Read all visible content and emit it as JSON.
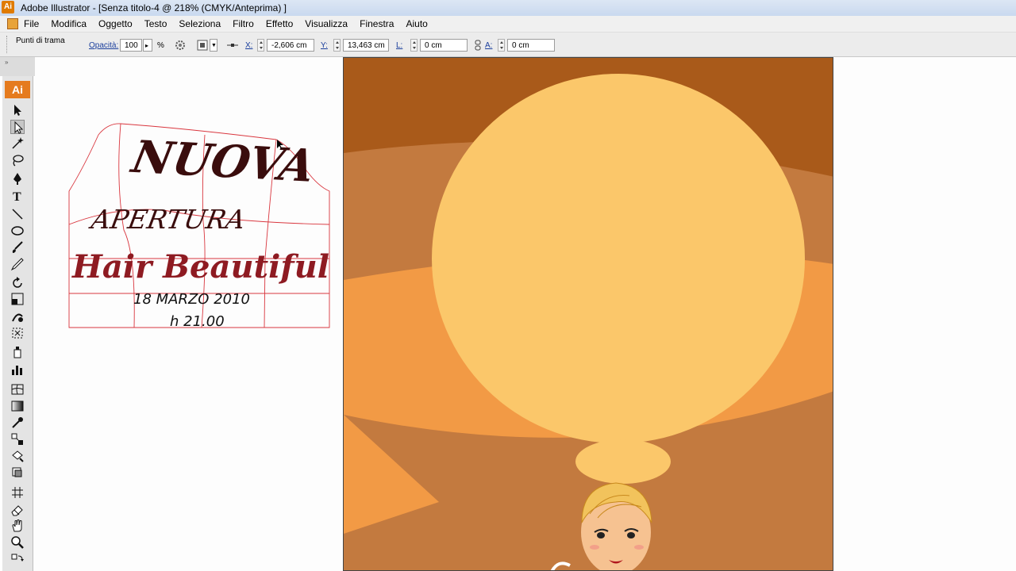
{
  "window": {
    "title": "Adobe Illustrator - [Senza titolo-4 @ 218% (CMYK/Anteprima) ]",
    "logo_text": "Ai"
  },
  "menu": {
    "items": [
      "File",
      "Modifica",
      "Oggetto",
      "Testo",
      "Seleziona",
      "Filtro",
      "Effetto",
      "Visualizza",
      "Finestra",
      "Aiuto"
    ]
  },
  "control_bar": {
    "selection_type": "Punti di trama",
    "opacity_label": "Opacità:",
    "opacity_value": "100",
    "opacity_unit": "%",
    "x_label": "X:",
    "x_value": "-2,606 cm",
    "y_label": "Y:",
    "y_value": "13,463 cm",
    "w_label": "L:",
    "w_value": "0 cm",
    "h_label": "A:",
    "h_value": "0 cm"
  },
  "tools": {
    "logo_text": "Ai",
    "items": [
      "selection-tool-icon",
      "direct-selection-tool-icon",
      "magic-wand-icon",
      "lasso-icon",
      "pen-icon",
      "type-icon",
      "line-icon",
      "ellipse-icon",
      "paintbrush-icon",
      "pencil-icon",
      "rotate-icon",
      "scale-icon",
      "warp-icon",
      "free-transform-icon",
      "symbol-sprayer-icon",
      "graph-icon",
      "mesh-icon",
      "gradient-icon",
      "eyedropper-icon",
      "blend-icon",
      "live-paint-icon",
      "live-paint-selection-icon",
      "slice-icon",
      "eraser-icon",
      "hand-icon",
      "zoom-icon"
    ]
  },
  "artwork": {
    "line1": "NUOVA",
    "line2": "APERTURA",
    "line3": "Hair Beautiful",
    "line4": "18 MARZO 2010",
    "line5": "h 21.00",
    "colors": {
      "dark_text": "#3a0d0d",
      "red_text": "#8e1b22",
      "envelope_mesh": "#d9363e",
      "bg_dark": "#a95a1a",
      "bg_mid": "#c37a3f",
      "bg_orange": "#f29a45",
      "sun": "#fbc76a"
    }
  }
}
